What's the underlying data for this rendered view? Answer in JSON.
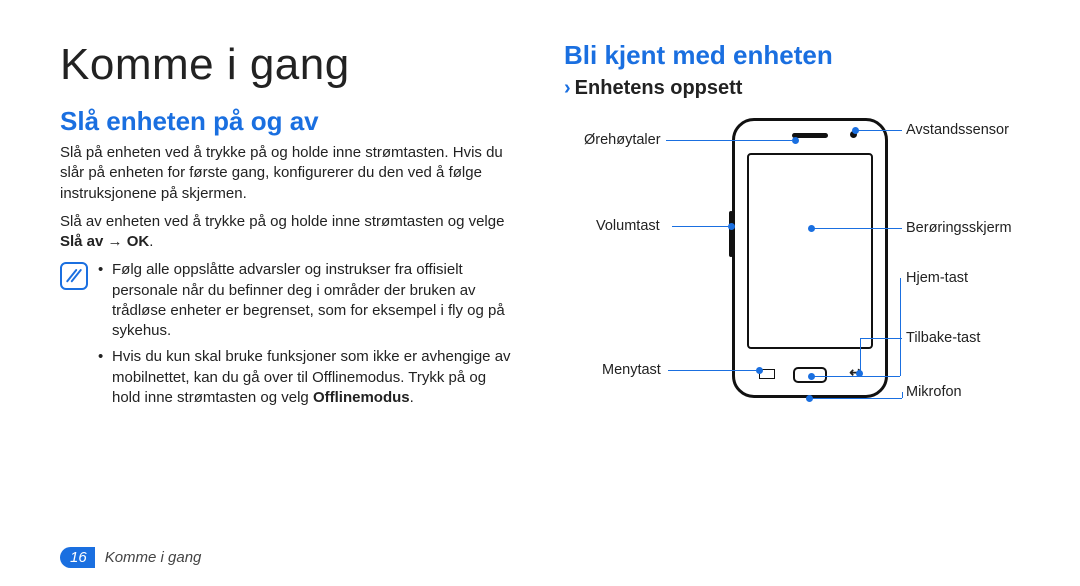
{
  "page": {
    "title": "Komme i gang",
    "number": "16",
    "footer_section": "Komme i gang"
  },
  "left": {
    "heading": "Slå enheten på og av",
    "p1": "Slå på enheten ved å trykke på og holde inne strømtasten. Hvis du slår på enheten for første gang, konfigurerer du den ved å følge instruksjonene på skjermen.",
    "p2_a": "Slå av enheten ved å trykke på og holde inne strømtasten og velge ",
    "p2_b": "Slå av → OK",
    "p2_c": ".",
    "note1": "Følg alle oppslåtte advarsler og instrukser fra offisielt personale når du befinner deg i områder der bruken av trådløse enheter er begrenset, som for eksempel i fly og på sykehus.",
    "note2_a": "Hvis du kun skal bruke funksjoner som ikke er avhengige av mobilnettet, kan du gå over til Offlinemodus. Trykk på og hold inne strømtasten og velg ",
    "note2_b": "Offlinemodus",
    "note2_c": "."
  },
  "right": {
    "heading": "Bli kjent med enheten",
    "sub_chev": "›",
    "subheading": "Enhetens oppsett",
    "labels": {
      "ear": "Ørehøytaler",
      "vol": "Volumtast",
      "menu": "Menytast",
      "prox": "Avstandssensor",
      "touch": "Berøringsskjerm",
      "home": "Hjem-tast",
      "back": "Tilbake-tast",
      "mic": "Mikrofon"
    }
  }
}
